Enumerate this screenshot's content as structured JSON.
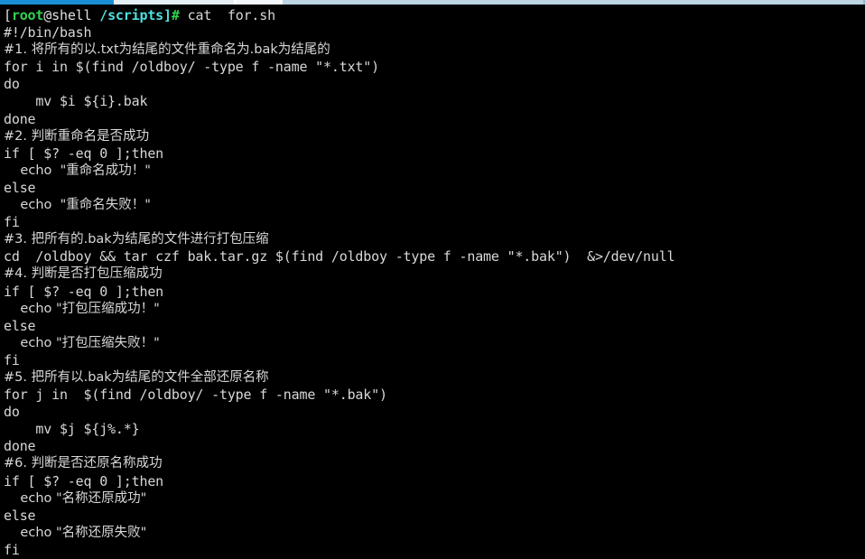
{
  "window": {
    "title": "terminal",
    "background_color": "#000000",
    "foreground_color": "#d8d8d8"
  },
  "top_strip": {
    "accent_color": "#1a8fd8",
    "track_color": "#c9dde8"
  },
  "prompt": {
    "open_bracket": "[",
    "user": "root",
    "at_host": "@shell",
    "path": " /scripts",
    "close_bracket": "]",
    "sigil": "#",
    "command": " cat  for.sh",
    "user_color": "#2fd34f",
    "path_color": "#4fe0e0",
    "sigil_color": "#2fd34f"
  },
  "script": {
    "file_name": "for.sh",
    "lines": [
      {
        "text": "#!/bin/bash",
        "cjk": false
      },
      {
        "text": "#1. 将所有的以.txt为结尾的文件重命名为.bak为结尾的",
        "cjk": true
      },
      {
        "text": "for i in $(find /oldboy/ -type f -name \"*.txt\")",
        "cjk": false
      },
      {
        "text": "do",
        "cjk": false
      },
      {
        "text": "    mv $i ${i}.bak",
        "cjk": false
      },
      {
        "text": "done",
        "cjk": false
      },
      {
        "text": "#2. 判断重命名是否成功",
        "cjk": true
      },
      {
        "text": "if [ $? -eq 0 ];then",
        "cjk": false
      },
      {
        "text": "    echo  \"重命名成功！\"",
        "cjk": true
      },
      {
        "text": "else",
        "cjk": false
      },
      {
        "text": "    echo  \"重命名失败！\"",
        "cjk": true
      },
      {
        "text": "fi",
        "cjk": false
      },
      {
        "text": "#3. 把所有的.bak为结尾的文件进行打包压缩",
        "cjk": true
      },
      {
        "text": "cd  /oldboy && tar czf bak.tar.gz $(find /oldboy -type f -name \"*.bak\")  &>/dev/null",
        "cjk": false
      },
      {
        "text": "#4. 判断是否打包压缩成功",
        "cjk": true
      },
      {
        "text": "if [ $? -eq 0 ];then",
        "cjk": false
      },
      {
        "text": "    echo \"打包压缩成功！\"",
        "cjk": true
      },
      {
        "text": "else",
        "cjk": false
      },
      {
        "text": "    echo \"打包压缩失败！\"",
        "cjk": true
      },
      {
        "text": "fi",
        "cjk": false
      },
      {
        "text": "#5. 把所有以.bak为结尾的文件全部还原名称",
        "cjk": true
      },
      {
        "text": "for j in  $(find /oldboy/ -type f -name \"*.bak\")",
        "cjk": false
      },
      {
        "text": "do",
        "cjk": false
      },
      {
        "text": "    mv $j ${j%.*}",
        "cjk": false
      },
      {
        "text": "done",
        "cjk": false
      },
      {
        "text": "#6. 判断是否还原名称成功",
        "cjk": true
      },
      {
        "text": "if [ $? -eq 0 ];then",
        "cjk": false
      },
      {
        "text": "    echo \"名称还原成功\"",
        "cjk": true
      },
      {
        "text": "else",
        "cjk": false
      },
      {
        "text": "    echo \"名称还原失败\"",
        "cjk": true
      },
      {
        "text": "fi",
        "cjk": false
      }
    ]
  }
}
